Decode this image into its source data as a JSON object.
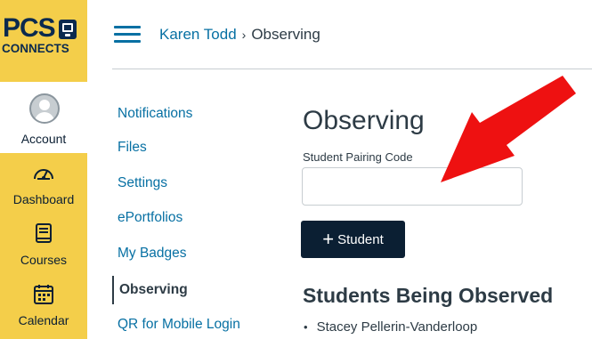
{
  "brand": {
    "logo_top": "PCS",
    "logo_bottom": "CONNECTS",
    "brand_yellow": "#f4ce4a",
    "brand_navy": "#0b2a4e"
  },
  "global_nav": {
    "items": [
      {
        "label": "Account",
        "icon": "user-avatar-icon"
      },
      {
        "label": "Dashboard",
        "icon": "speedometer-icon"
      },
      {
        "label": "Courses",
        "icon": "book-icon"
      },
      {
        "label": "Calendar",
        "icon": "calendar-icon"
      }
    ]
  },
  "header": {
    "menu_icon": "hamburger-icon",
    "breadcrumb": {
      "user": "Karen Todd",
      "separator": "›",
      "current": "Observing"
    }
  },
  "subnav": {
    "items": [
      {
        "label": "Notifications",
        "active": false
      },
      {
        "label": "Files",
        "active": false
      },
      {
        "label": "Settings",
        "active": false
      },
      {
        "label": "ePortfolios",
        "active": false
      },
      {
        "label": "My Badges",
        "active": false
      },
      {
        "label": "Observing",
        "active": true
      },
      {
        "label": "QR for Mobile Login",
        "active": false
      }
    ]
  },
  "main": {
    "title": "Observing",
    "pairing_label": "Student Pairing Code",
    "pairing_value": "",
    "add_button_plus": "+",
    "add_button_label": "Student",
    "observed_title": "Students Being Observed",
    "observed_students": [
      "Stacey Pellerin-Vanderloop"
    ]
  },
  "annotation": {
    "arrow_color": "#ee1111",
    "arrow_target": "student-pairing-code-input"
  },
  "colors": {
    "link": "#0770a3",
    "text": "#2d3b45",
    "button_bg": "#0b1f33",
    "border": "#c7cdd1"
  }
}
